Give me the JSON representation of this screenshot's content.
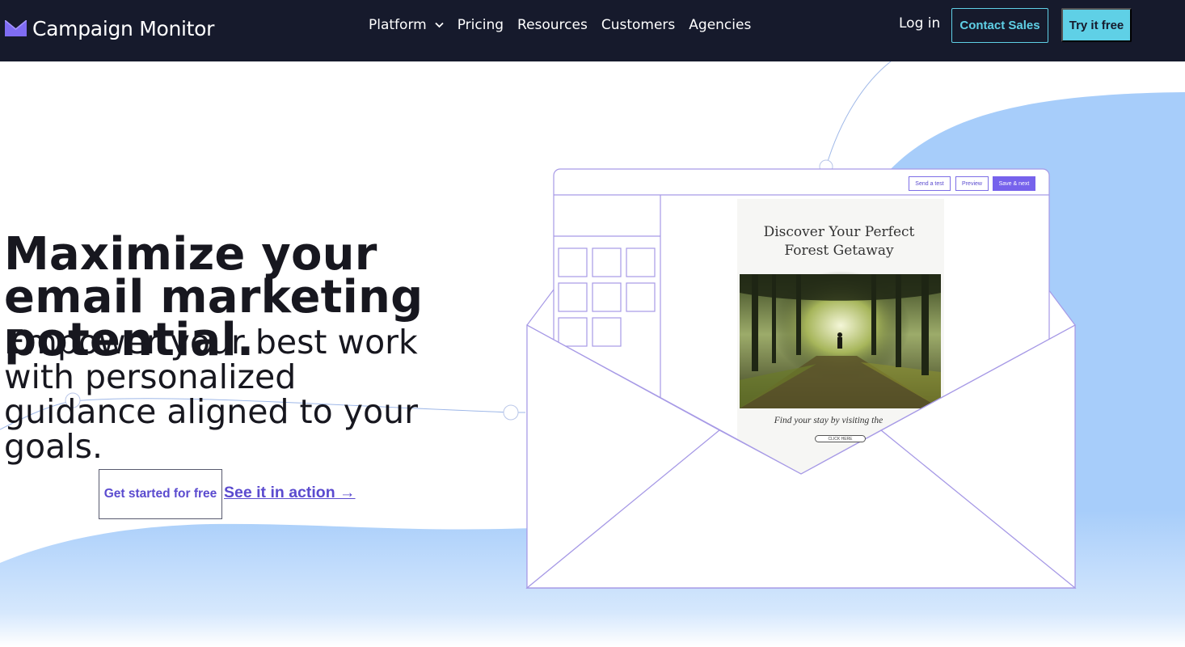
{
  "nav": {
    "brand": "Campaign Monitor",
    "links": [
      "Platform",
      "Pricing",
      "Resources",
      "Customers",
      "Agencies"
    ],
    "login": "Log in",
    "contact_sales": "Contact Sales",
    "try_free": "Try it free"
  },
  "hero": {
    "headline": "Maximize your email marketing potential.",
    "subheadline": "Empower your best work with personalized guidance aligned to your goals.",
    "cta_primary": "Get started for free",
    "cta_secondary": "See it in action →"
  },
  "illustration": {
    "toolbar": {
      "send_test": "Send a test",
      "preview": "Preview",
      "save_next": "Save & next"
    },
    "email_title": "Discover Your Perfect Forest Getaway",
    "email_caption": "Find your stay by visiting the",
    "email_button": "CLICK HERE"
  },
  "colors": {
    "nav_bg": "#161a2c",
    "accent_cyan": "#5fd0e6",
    "accent_purple": "#5b4bcf",
    "wave_blue": "#a7cdfa"
  },
  "icons": {
    "logo": "envelope-logo-icon",
    "dropdown": "chevron-down-icon"
  }
}
